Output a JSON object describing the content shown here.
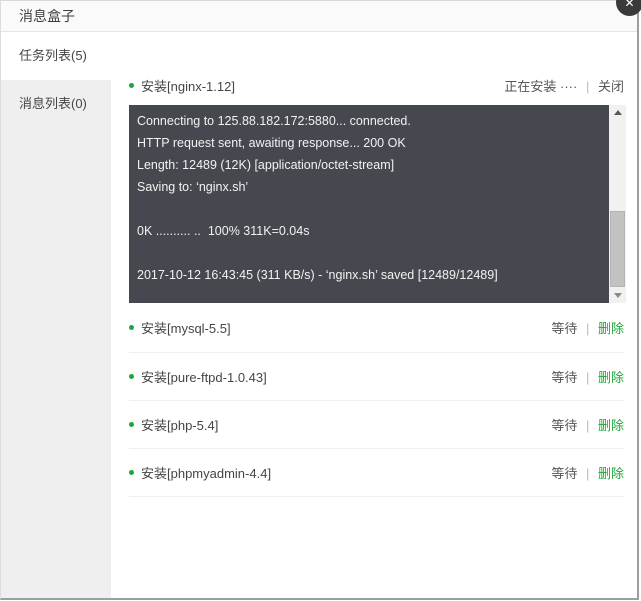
{
  "dialog": {
    "title": "消息盒子",
    "close_icon": "✕"
  },
  "sidebar": {
    "items": [
      {
        "label": "任务列表(5)",
        "active": true
      },
      {
        "label": "消息列表(0)",
        "active": false
      }
    ]
  },
  "active_task": {
    "label": "安装[nginx-1.12]",
    "status": "正在安装 ····",
    "separator": "|",
    "action": "关闭"
  },
  "console": {
    "lines": [
      "Connecting to 125.88.182.172:5880... connected.",
      "HTTP request sent, awaiting response... 200 OK",
      "Length: 12489 (12K) [application/octet-stream]",
      "Saving to: ‘nginx.sh’",
      "",
      "0K .......... ..  100% 311K=0.04s",
      "",
      "2017-10-12 16:43:45 (311 KB/s) - ‘nginx.sh’ saved [12489/12489]"
    ]
  },
  "pending_tasks": [
    {
      "label": "安装[mysql-5.5]",
      "status": "等待",
      "separator": "|",
      "action": "删除"
    },
    {
      "label": "安装[pure-ftpd-1.0.43]",
      "status": "等待",
      "separator": "|",
      "action": "删除"
    },
    {
      "label": "安装[php-5.4]",
      "status": "等待",
      "separator": "|",
      "action": "删除"
    },
    {
      "label": "安装[phpmyadmin-4.4]",
      "status": "等待",
      "separator": "|",
      "action": "删除"
    }
  ],
  "colors": {
    "accent_green": "#20a53a",
    "console_bg": "#45484f",
    "sidebar_bg": "#efefef",
    "header_bg": "#fafafa",
    "close_btn_bg": "#3a3a3a"
  }
}
